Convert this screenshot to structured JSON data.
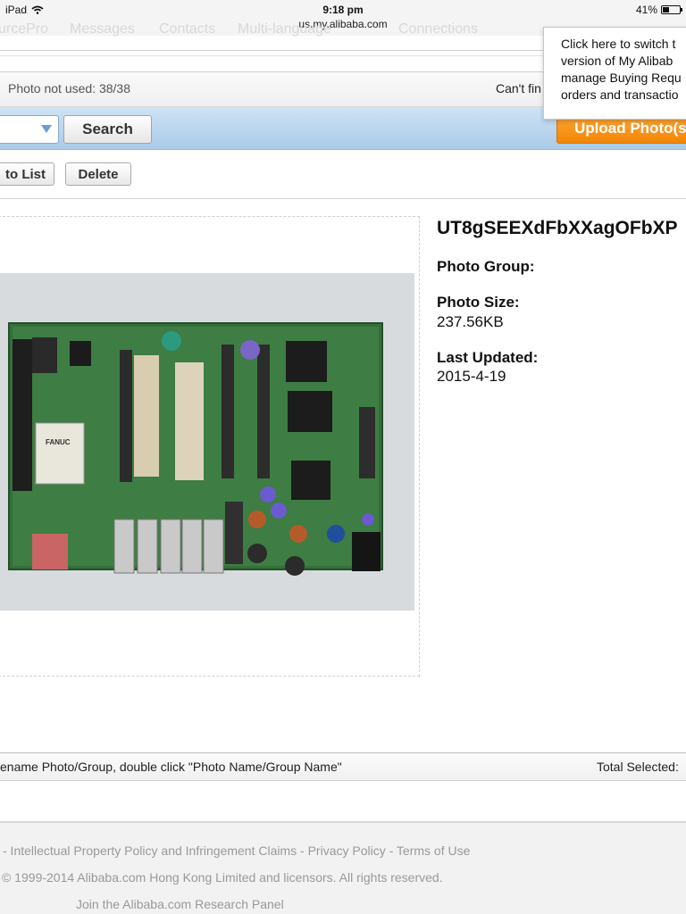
{
  "status_bar": {
    "device": "iPad",
    "time": "9:18 pm",
    "url": "us.my.alibaba.com",
    "battery": "41%",
    "battery_level": 0.41,
    "icons": [
      "wifi-icon",
      "battery-icon"
    ]
  },
  "nav_faded": [
    "urcePro",
    "Messages",
    "Contacts",
    "Multi-language",
    "Connections"
  ],
  "tooltip": {
    "lines": [
      "Click here to switch t",
      "version of My Alibab",
      "manage Buying Requ",
      "orders and transactio"
    ]
  },
  "info_bar": {
    "photo_not_used": "Photo not used: 38/38",
    "cant_find": "Can't fin"
  },
  "search_bar": {
    "search_label": "Search",
    "upload_label": "Upload Photo(s",
    "accent_color": "#f28705"
  },
  "actions": {
    "add_to_list": "to List",
    "delete": "Delete"
  },
  "photo_detail": {
    "name": "UT8gSEEXdFbXXagOFbXP",
    "group_label": "Photo Group:",
    "group_value": "",
    "size_label": "Photo Size:",
    "size_value": "237.56KB",
    "updated_label": "Last Updated:",
    "updated_value": "2015-4-19",
    "board_text": "FANUC"
  },
  "bottom_bar": {
    "hint": "ename Photo/Group, double click \"Photo Name/Group Name\"",
    "total_selected": "Total Selected:"
  },
  "footer": {
    "links": "- Intellectual Property Policy and Infringement Claims - Privacy Policy - Terms of Use",
    "copyright": "© 1999-2014 Alibaba.com Hong Kong Limited and licensors. All rights reserved.",
    "research_panel": "Join the Alibaba.com Research Panel"
  }
}
